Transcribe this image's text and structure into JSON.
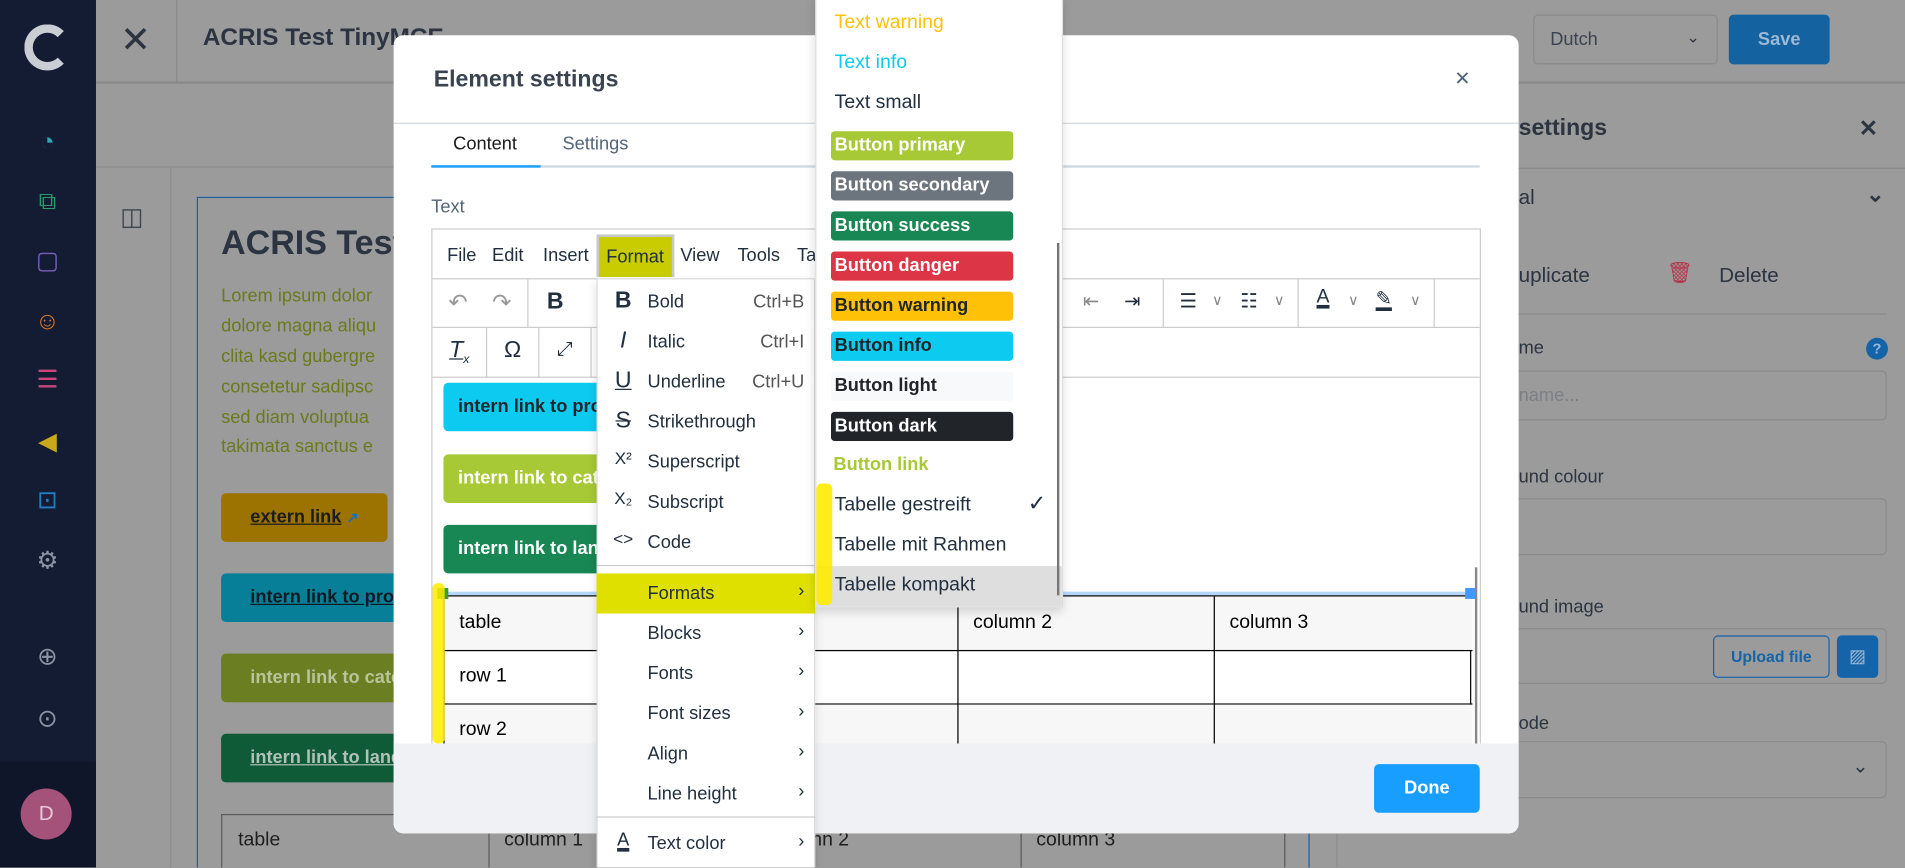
{
  "sidebar": {
    "icons": [
      "shopware-logo-icon",
      "dashboard-icon",
      "catalogue-icon",
      "orders-icon",
      "customers-icon",
      "content-icon",
      "marketing-icon",
      "extensions-icon",
      "settings-icon",
      "add-icon",
      "expand-icon"
    ],
    "avatar_initial": "D",
    "colors": {
      "bg": "#141c33"
    }
  },
  "topbar": {
    "title": "ACRIS Test TinyMCE",
    "language": "Dutch",
    "save": "Save"
  },
  "canvas": {
    "heading": "ACRIS Test",
    "lorem": [
      "Lorem ipsum dolor",
      "dolore magna aliqu",
      "clita kasd gubergre",
      "consetetur sadipsc",
      "sed diam voluptua",
      "takimata sanctus e"
    ],
    "buttons": [
      "extern link",
      "intern link to prod",
      "intern link to cate",
      "intern link to land"
    ],
    "table": [
      "table",
      "column 1",
      "column 2",
      "column 3"
    ]
  },
  "right_panel": {
    "title": "settings",
    "section": "al",
    "duplicate": "uplicate",
    "delete": "Delete",
    "name_label": "me",
    "name_placeholder": "name...",
    "bg_colour_label": "und colour",
    "bg_image_label": "und image",
    "upload": "Upload file",
    "mode_label": "ode"
  },
  "modal": {
    "title": "Element settings",
    "tabs": [
      "Content",
      "Settings"
    ],
    "active_tab": "Content",
    "text_label": "Text",
    "done": "Done",
    "menubar": [
      "File",
      "Edit",
      "Insert",
      "Format",
      "View",
      "Tools",
      "Ta"
    ],
    "content_buttons": [
      "intern link to pro",
      "intern link to cate",
      "intern link to lan"
    ],
    "table": {
      "header": [
        "table",
        "",
        "column 2",
        "column 3"
      ],
      "rows": [
        [
          "row 1",
          "",
          "",
          ""
        ],
        [
          "row 2",
          "",
          "",
          ""
        ]
      ]
    }
  },
  "format_menu": {
    "items": [
      {
        "icon": "B",
        "label": "Bold",
        "shortcut": "Ctrl+B"
      },
      {
        "icon": "I",
        "label": "Italic",
        "shortcut": "Ctrl+I"
      },
      {
        "icon": "U",
        "label": "Underline",
        "shortcut": "Ctrl+U"
      },
      {
        "icon": "S",
        "label": "Strikethrough"
      },
      {
        "icon": "X²",
        "label": "Superscript"
      },
      {
        "icon": "X₂",
        "label": "Subscript"
      },
      {
        "icon": "<>",
        "label": "Code"
      }
    ],
    "submenus": [
      "Formats",
      "Blocks",
      "Fonts",
      "Font sizes",
      "Align",
      "Line height"
    ],
    "active_submenu": "Formats",
    "text_color": "Text color"
  },
  "formats_submenu": {
    "text_items": [
      {
        "label": "Text warning",
        "color": "#ffc107"
      },
      {
        "label": "Text info",
        "color": "#0dcaf0"
      },
      {
        "label": "Text small",
        "color": "#222f3e"
      }
    ],
    "button_items": [
      {
        "label": "Button primary",
        "bg": "#a8c936",
        "fg": "#ffffff"
      },
      {
        "label": "Button secondary",
        "bg": "#6c757d",
        "fg": "#ffffff"
      },
      {
        "label": "Button success",
        "bg": "#198754",
        "fg": "#ffffff"
      },
      {
        "label": "Button danger",
        "bg": "#dc3545",
        "fg": "#ffffff"
      },
      {
        "label": "Button warning",
        "bg": "#ffc107",
        "fg": "#212529"
      },
      {
        "label": "Button info",
        "bg": "#0dcaf0",
        "fg": "#212529"
      },
      {
        "label": "Button light",
        "bg": "#f8f9fa",
        "fg": "#212529"
      },
      {
        "label": "Button dark",
        "bg": "#212529",
        "fg": "#ffffff"
      }
    ],
    "button_link": "Button link",
    "table_items": [
      {
        "label": "Tabelle gestreift",
        "checked": true
      },
      {
        "label": "Tabelle mit Rahmen",
        "checked": false
      },
      {
        "label": "Tabelle kompakt",
        "checked": false,
        "hovered": true
      }
    ]
  }
}
